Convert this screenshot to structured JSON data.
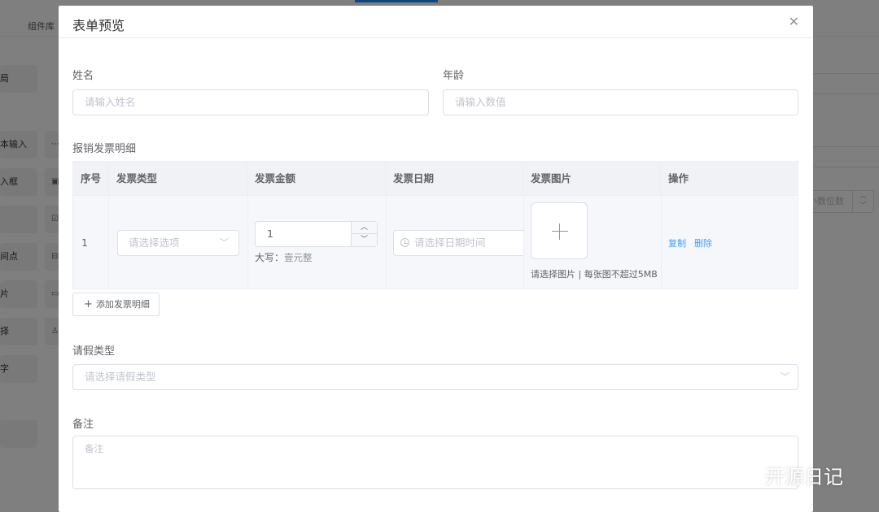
{
  "background": {
    "top_tab": "组件库",
    "left_items": [
      "局",
      "本输入",
      "入框",
      "",
      "间点",
      "片",
      "择",
      "字",
      ""
    ],
    "right_number_placeholder": "小数位数"
  },
  "modal": {
    "title": "表单预览",
    "close_icon": "close-icon"
  },
  "form": {
    "name": {
      "label": "姓名",
      "placeholder": "请输入姓名"
    },
    "age": {
      "label": "年龄",
      "placeholder": "请输入数值"
    },
    "invoice": {
      "label": "报销发票明细",
      "columns": [
        "序号",
        "发票类型",
        "发票金额",
        "发票日期",
        "发票图片",
        "操作"
      ],
      "rows": [
        {
          "index": "1",
          "type_placeholder": "请选择选项",
          "amount": "1",
          "amount_caption": "大写：",
          "amount_words": "壹元整",
          "date_placeholder": "请选择日期时间",
          "image_tip": "请选择图片 | 每张图不超过5MB",
          "actions": [
            "复制",
            "删除"
          ]
        }
      ],
      "add_button": "添加发票明细"
    },
    "leave_type": {
      "label": "请假类型",
      "placeholder": "请选择请假类型"
    },
    "remark": {
      "label": "备注",
      "placeholder": "备注"
    }
  },
  "watermark": {
    "text": "开源日记"
  }
}
